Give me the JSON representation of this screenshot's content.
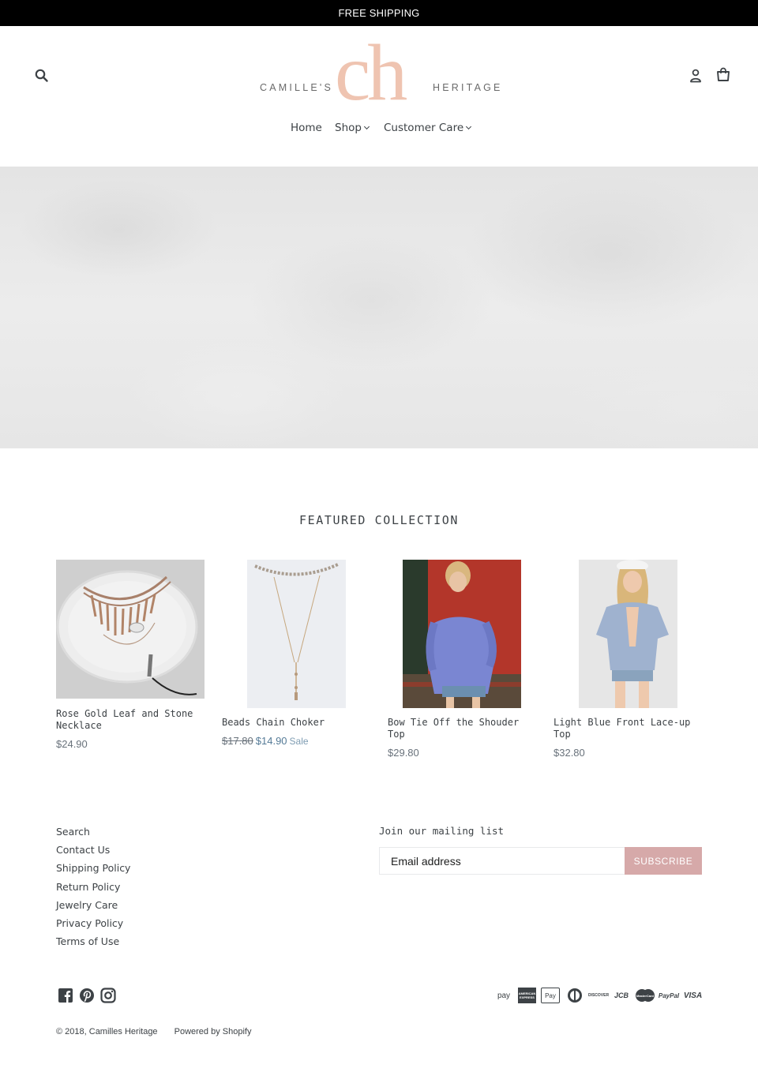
{
  "announcement": "FREE SHIPPING",
  "logo": {
    "left_word": "CAMILLE'S",
    "monogram": "ch",
    "right_word": "HERITAGE"
  },
  "nav": {
    "home": "Home",
    "shop": "Shop",
    "customer_care": "Customer Care"
  },
  "icons": {
    "search": "search-icon",
    "account": "user-icon",
    "cart": "cart-icon"
  },
  "featured": {
    "title": "FEATURED COLLECTION",
    "products": [
      {
        "name": "Rose Gold Leaf and Stone Necklace",
        "price": "$24.90"
      },
      {
        "name": "Beads Chain Choker",
        "old_price": "$17.80",
        "price": "$14.90",
        "sale_label": "Sale"
      },
      {
        "name": "Bow Tie Off the Shouder Top",
        "price": "$29.80"
      },
      {
        "name": "Light Blue Front Lace-up Top",
        "price": "$32.80"
      }
    ]
  },
  "footer": {
    "links": [
      "Search",
      "Contact Us",
      "Shipping Policy",
      "Return Policy",
      "Jewelry Care",
      "Privacy Policy",
      "Terms of Use"
    ],
    "mailing_title": "Join our mailing list",
    "email_placeholder": "Email address",
    "subscribe_label": "SUBSCRIBE",
    "social": [
      "facebook-icon",
      "pinterest-icon",
      "instagram-icon"
    ],
    "payments": {
      "amazon": "pay",
      "amex": "AMERICAN EXPRESS",
      "apple": "Pay",
      "discover": "DISCOVER",
      "jcb": "JCB",
      "master": "MasterCard",
      "paypal": "PayPal",
      "visa": "VISA"
    },
    "copyright": "© 2018, Camilles Heritage",
    "powered": "Powered by Shopify"
  },
  "colors": {
    "accent": "#efc4b1",
    "subscribe": "#d6a9a9",
    "sale": "#557b97"
  }
}
